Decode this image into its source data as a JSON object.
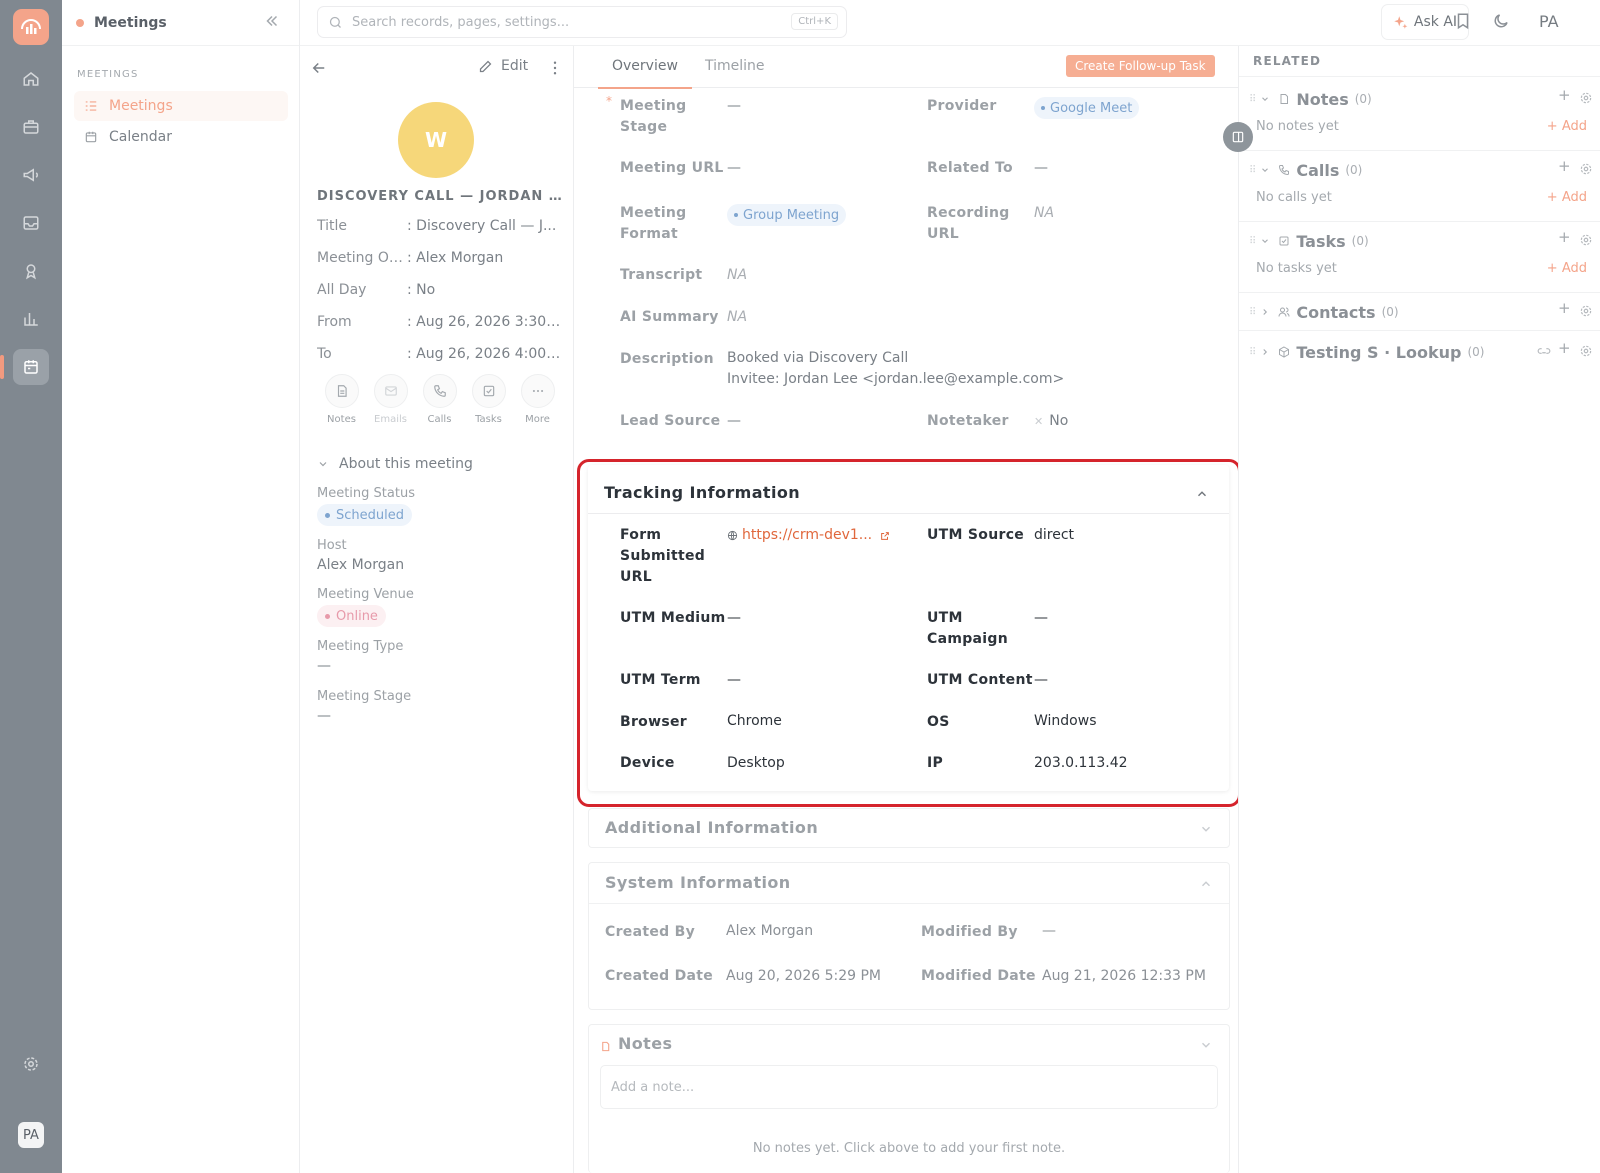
{
  "nav": {
    "title": "Meetings",
    "section": "MEETINGS",
    "items": [
      {
        "label": "Meetings",
        "icon": "list-icon",
        "selected": true
      },
      {
        "label": "Calendar",
        "icon": "calendar-icon",
        "selected": false
      }
    ]
  },
  "rail": {
    "avatar": "PA"
  },
  "topbar": {
    "search_placeholder": "Search records, pages, settings...",
    "shortcut": "Ctrl+K",
    "ask_ai": "Ask AI",
    "avatar": "PA"
  },
  "record": {
    "edit_label": "Edit",
    "avatar_letter": "W",
    "title_upper": "DISCOVERY CALL — JORDAN L...",
    "fields": [
      {
        "key": "Title",
        "value": ": Discovery Call — J..."
      },
      {
        "key": "Meeting Ow...",
        "value": ": Alex Morgan"
      },
      {
        "key": "All Day",
        "value": ": No"
      },
      {
        "key": "From",
        "value": ": Aug 26, 2026 3:30 ..."
      },
      {
        "key": "To",
        "value": ": Aug 26, 2026 4:00 ..."
      }
    ],
    "actions": [
      {
        "label": "Notes",
        "icon": "note-icon"
      },
      {
        "label": "Emails",
        "icon": "mail-icon"
      },
      {
        "label": "Calls",
        "icon": "phone-icon"
      },
      {
        "label": "Tasks",
        "icon": "task-icon"
      },
      {
        "label": "More",
        "icon": "more-icon"
      }
    ],
    "about": {
      "title": "About this meeting",
      "status_label": "Meeting Status",
      "status_value": "Scheduled",
      "host_label": "Host",
      "host_value": "Alex Morgan",
      "venue_label": "Meeting Venue",
      "venue_value": "Online",
      "type_label": "Meeting Type",
      "type_value": "—",
      "stage_label": "Meeting Stage",
      "stage_value": "—"
    }
  },
  "tabs": {
    "overview": "Overview",
    "timeline": "Timeline",
    "cta": "Create Follow-up Task"
  },
  "overview": {
    "meeting_stage_k": "Meeting Stage",
    "meeting_stage_v": "—",
    "provider_k": "Provider",
    "provider_v": "Google Meet",
    "meeting_url_k": "Meeting URL",
    "meeting_url_v": "—",
    "related_to_k": "Related To",
    "related_to_v": "—",
    "format_k": "Meeting Format",
    "format_v": "Group Meeting",
    "recording_k": "Recording URL",
    "recording_v": "NA",
    "transcript_k": "Transcript",
    "transcript_v": "NA",
    "ai_summary_k": "AI Summary",
    "ai_summary_v": "NA",
    "description_k": "Description",
    "description_v1": "Booked via Discovery Call",
    "description_v2": "Invitee: Jordan Lee <jordan.lee@example.com>",
    "lead_source_k": "Lead Source",
    "lead_source_v": "—",
    "notetaker_k": "Notetaker",
    "notetaker_v": "No"
  },
  "tracking": {
    "title": "Tracking Information",
    "form_url_k": "Form Submitted URL",
    "form_url_v": "https://crm-dev1...",
    "utm_source_k": "UTM Source",
    "utm_source_v": "direct",
    "utm_medium_k": "UTM Medium",
    "utm_medium_v": "—",
    "utm_campaign_k": "UTM Campaign",
    "utm_campaign_v": "—",
    "utm_term_k": "UTM Term",
    "utm_term_v": "—",
    "utm_content_k": "UTM Content",
    "utm_content_v": "—",
    "browser_k": "Browser",
    "browser_v": "Chrome",
    "os_k": "OS",
    "os_v": "Windows",
    "device_k": "Device",
    "device_v": "Desktop",
    "ip_k": "IP",
    "ip_v": "203.0.113.42"
  },
  "additional": {
    "title": "Additional Information"
  },
  "system": {
    "title": "System Information",
    "created_by_k": "Created By",
    "created_by_v": "Alex Morgan",
    "modified_by_k": "Modified By",
    "modified_by_v": "—",
    "created_date_k": "Created Date",
    "created_date_v": "Aug 20, 2026 5:29 PM",
    "modified_date_k": "Modified Date",
    "modified_date_v": "Aug 21, 2026 12:33 PM"
  },
  "notes_card": {
    "title": "Notes",
    "placeholder": "Add a note...",
    "empty": "No notes yet. Click above to add your first note."
  },
  "related": {
    "title": "RELATED",
    "sections": [
      {
        "name": "Notes",
        "count": "(0)",
        "empty": "No notes yet",
        "add": "+ Add"
      },
      {
        "name": "Calls",
        "count": "(0)",
        "empty": "No calls yet",
        "add": "+ Add"
      },
      {
        "name": "Tasks",
        "count": "(0)",
        "empty": "No tasks yet",
        "add": "+ Add"
      },
      {
        "name": "Contacts",
        "count": "(0)"
      },
      {
        "name": "Testing S · Lookup",
        "count": "(0)"
      }
    ]
  },
  "colors": {
    "accent": "#f4a48a",
    "highlight": "#d5242c",
    "link": "#e0673c"
  }
}
